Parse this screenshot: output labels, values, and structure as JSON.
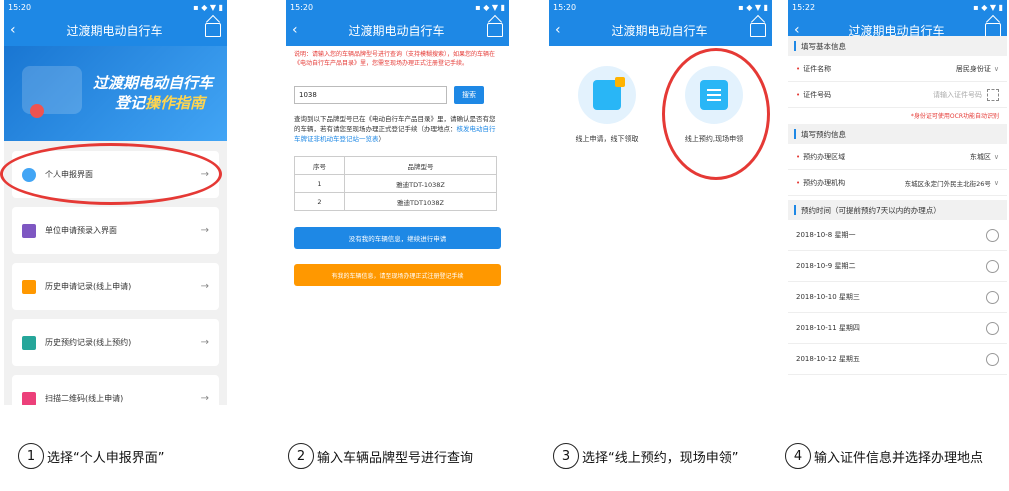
{
  "phone1": {
    "time": "15:20",
    "title": "过渡期电动自行车",
    "banner_line1": "过渡期电动自行车",
    "banner_line2_a": "登记",
    "banner_line2_b": "操作指南",
    "menu": [
      {
        "label": "个人申报界面",
        "icon": "person-icon",
        "color": "#42a5f5"
      },
      {
        "label": "单位申请预录入界面",
        "icon": "building-icon",
        "color": "#7e57c2"
      },
      {
        "label": "历史申请记录(线上申请)",
        "icon": "clipboard-icon",
        "color": "#ff9800"
      },
      {
        "label": "历史预约记录(线上预约)",
        "icon": "calendar-icon",
        "color": "#26a69a"
      },
      {
        "label": "扫描二维码(线上申请)",
        "icon": "qr-icon",
        "color": "#ec407a"
      }
    ]
  },
  "phone2": {
    "time": "15:20",
    "title": "过渡期电动自行车",
    "notice": "说明：请输入您的车辆品牌型号进行查询（支持模糊搜索），如果您的车辆在《电动自行车产品目录》里，您需至现场办理正式注册登记手续。",
    "search_value": "1038",
    "search_label": "搜索",
    "result_text": "查询到以下品牌型号已在《电动自行车产品目录》里，请确认是否有您的车辆，若有请您至现场办理正式登记手续（办理地点：",
    "result_link": "核发电动自行车牌证非机动车登记站一览表",
    "result_close": "）",
    "table_headers": [
      "序号",
      "品牌型号"
    ],
    "table_rows": [
      [
        "1",
        "雅迪TDT-1038Z"
      ],
      [
        "2",
        "雅迪TDT1038Z"
      ]
    ],
    "btn_blue": "没有我的车辆信息，继续进行申请",
    "btn_orange": "有我的车辆信息，请至现场办理正式注册登记手续"
  },
  "phone3": {
    "time": "15:20",
    "title": "过渡期电动自行车",
    "option1": "线上申请，线下领取",
    "option2": "线上预约,现场申领"
  },
  "phone4": {
    "time": "15:22",
    "title": "过渡期电动自行车",
    "section1": "填写基本信息",
    "id_type_label": "证件名称",
    "id_type_value": "居民身份证",
    "id_no_label": "证件号码",
    "id_no_placeholder": "请输入证件号码",
    "ocr_note": "*身份证可使用OCR功能自动识别",
    "section2": "填写预约信息",
    "area_label": "预约办理区域",
    "area_value": "东城区",
    "org_label": "预约办理机构",
    "org_value": "东城区永定门外民主北街26号",
    "section3": "预约时间（可提前预约7天以内的办理点）",
    "dates": [
      "2018-10-8 星期一",
      "2018-10-9 星期二",
      "2018-10-10 星期三",
      "2018-10-11 星期四",
      "2018-10-12 星期五"
    ]
  },
  "captions": [
    {
      "num": "1",
      "text": "选择“个人申报界面”"
    },
    {
      "num": "2",
      "text": "输入车辆品牌型号进行查询"
    },
    {
      "num": "3",
      "text": "选择“线上预约，现场申领”"
    },
    {
      "num": "4",
      "text": "输入证件信息并选择办理地点"
    }
  ],
  "colors": {
    "primary": "#1e88e5",
    "highlight": "#e53935",
    "orange": "#ff9800"
  }
}
